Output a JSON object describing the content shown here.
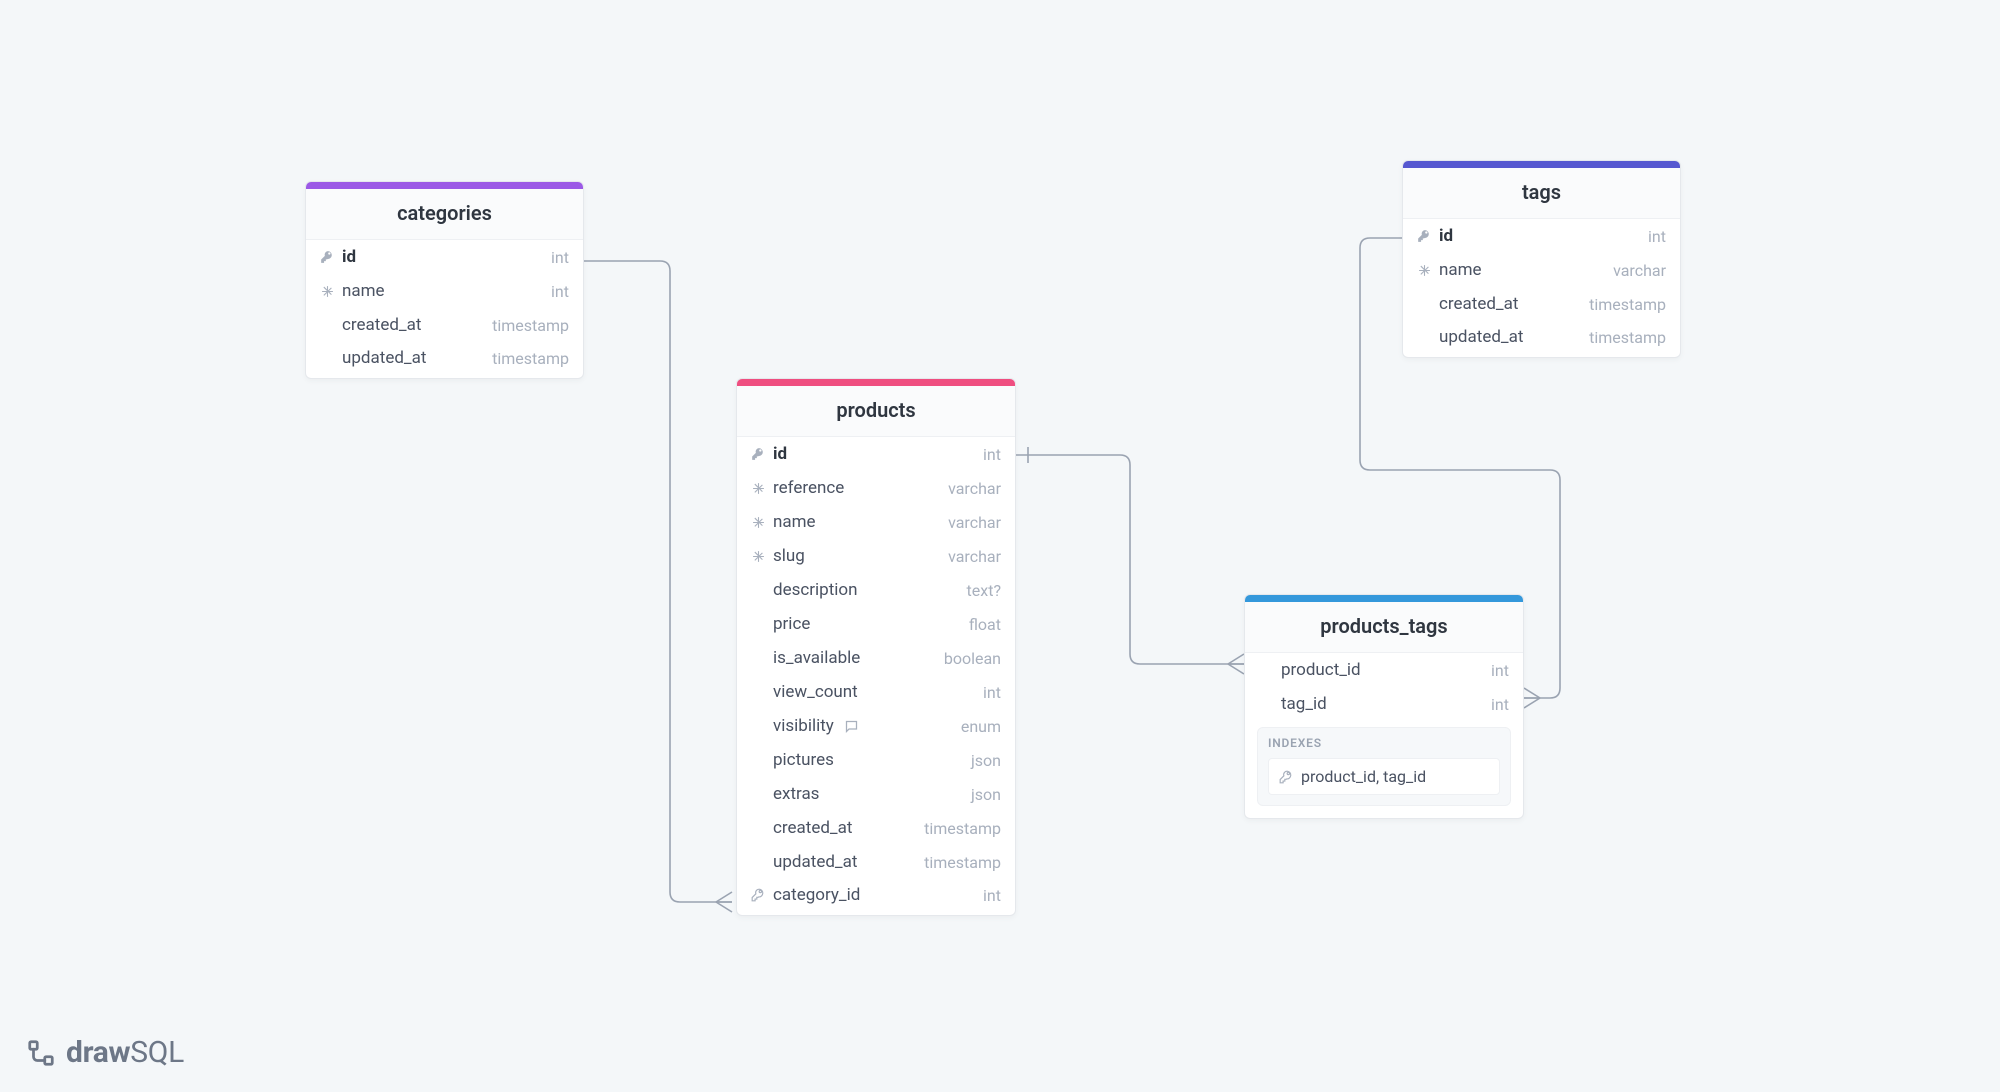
{
  "brand": {
    "part1": "draw",
    "part2": "SQL"
  },
  "colors": {
    "categories": "#9b59e6",
    "products": "#ef4e80",
    "tags": "#5658d0",
    "products_tags": "#3498db"
  },
  "tables": {
    "categories": {
      "title": "categories",
      "cols": [
        {
          "icon": "key",
          "name": "id",
          "type": "int",
          "bold": true
        },
        {
          "icon": "snow",
          "name": "name",
          "type": "int",
          "bold": false
        },
        {
          "icon": "",
          "name": "created_at",
          "type": "timestamp",
          "bold": false
        },
        {
          "icon": "",
          "name": "updated_at",
          "type": "timestamp",
          "bold": false
        }
      ]
    },
    "products": {
      "title": "products",
      "cols": [
        {
          "icon": "key",
          "name": "id",
          "type": "int",
          "bold": true
        },
        {
          "icon": "snow",
          "name": "reference",
          "type": "varchar",
          "bold": false
        },
        {
          "icon": "snow",
          "name": "name",
          "type": "varchar",
          "bold": false
        },
        {
          "icon": "snow",
          "name": "slug",
          "type": "varchar",
          "bold": false
        },
        {
          "icon": "",
          "name": "description",
          "type": "text?",
          "bold": false
        },
        {
          "icon": "",
          "name": "price",
          "type": "float",
          "bold": false
        },
        {
          "icon": "",
          "name": "is_available",
          "type": "boolean",
          "bold": false
        },
        {
          "icon": "",
          "name": "view_count",
          "type": "int",
          "bold": false
        },
        {
          "icon": "",
          "name": "visibility",
          "type": "enum",
          "bold": false,
          "comment": true
        },
        {
          "icon": "",
          "name": "pictures",
          "type": "json",
          "bold": false
        },
        {
          "icon": "",
          "name": "extras",
          "type": "json",
          "bold": false
        },
        {
          "icon": "",
          "name": "created_at",
          "type": "timestamp",
          "bold": false
        },
        {
          "icon": "",
          "name": "updated_at",
          "type": "timestamp",
          "bold": false
        },
        {
          "icon": "fk",
          "name": "category_id",
          "type": "int",
          "bold": false
        }
      ]
    },
    "tags": {
      "title": "tags",
      "cols": [
        {
          "icon": "key",
          "name": "id",
          "type": "int",
          "bold": true
        },
        {
          "icon": "snow",
          "name": "name",
          "type": "varchar",
          "bold": false
        },
        {
          "icon": "",
          "name": "created_at",
          "type": "timestamp",
          "bold": false
        },
        {
          "icon": "",
          "name": "updated_at",
          "type": "timestamp",
          "bold": false
        }
      ]
    },
    "products_tags": {
      "title": "products_tags",
      "cols": [
        {
          "icon": "",
          "name": "product_id",
          "type": "int",
          "bold": false
        },
        {
          "icon": "",
          "name": "tag_id",
          "type": "int",
          "bold": false
        }
      ],
      "indexes_label": "INDEXES",
      "indexes": [
        {
          "cols": "product_id, tag_id"
        }
      ]
    }
  }
}
